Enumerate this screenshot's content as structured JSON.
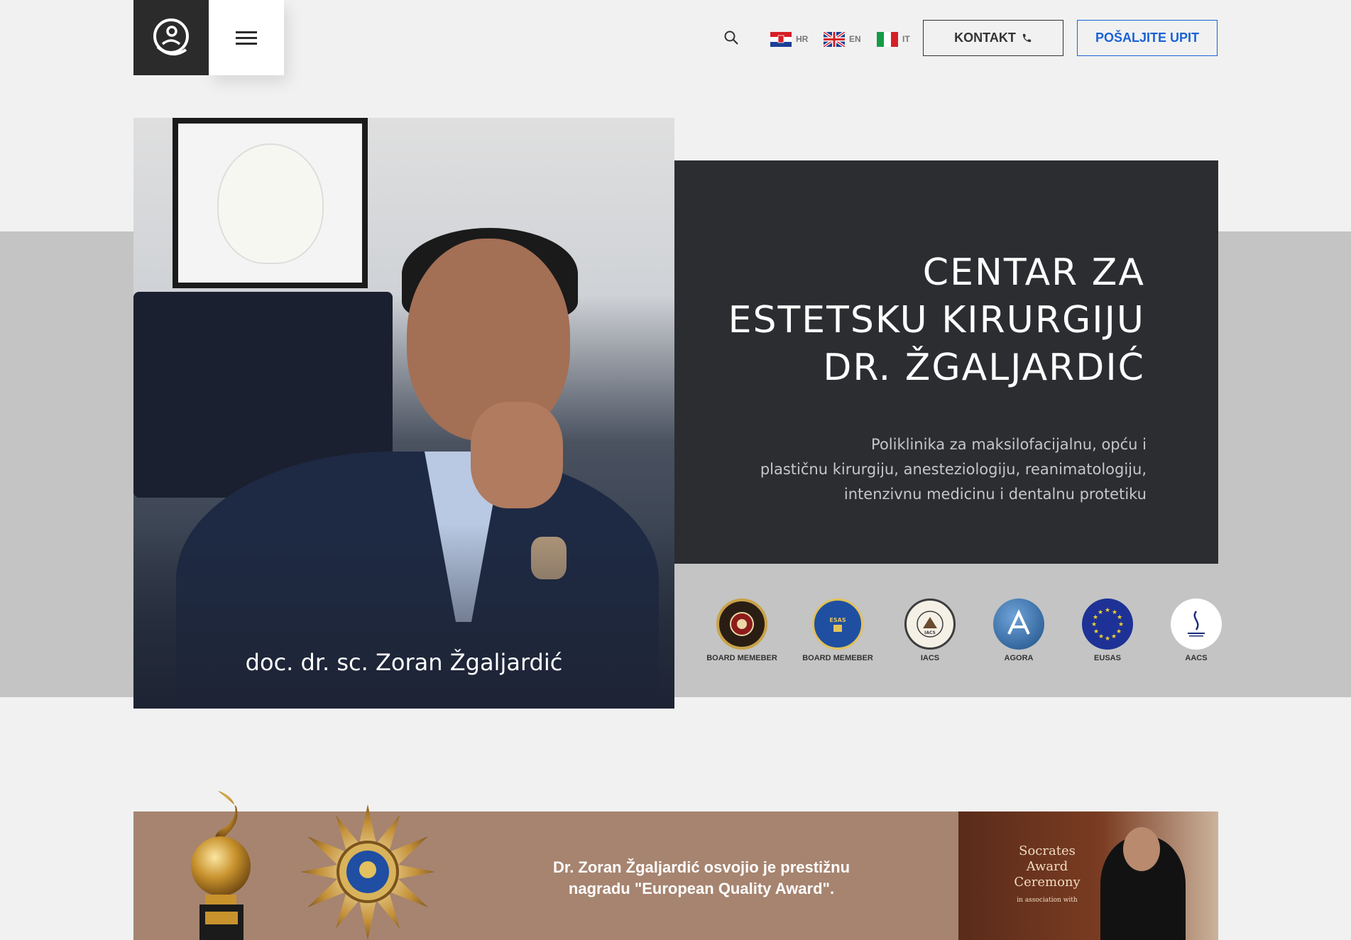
{
  "header": {
    "logo_alt": "logo",
    "languages": [
      {
        "code": "HR",
        "flag": "flag-hr"
      },
      {
        "code": "EN",
        "flag": "flag-uk"
      },
      {
        "code": "IT",
        "flag": "flag-it"
      }
    ],
    "contact_label": "KONTAKT",
    "inquiry_label": "POŠALJITE UPIT",
    "accent_color": "#1a62d6"
  },
  "hero": {
    "title_lines": [
      "CENTAR ZA",
      "ESTETSKU KIRURGIJU",
      "DR. ŽGALJARDIĆ"
    ],
    "subtitle_lines": [
      "Poliklinika za maksilofacijalnu, opću i",
      "plastičnu kirurgiju, anesteziologiju, reanimatologiju,",
      "intenzivnu medicinu i dentalnu protetiku"
    ],
    "photo_caption": "doc. dr. sc. Zoran Žgaljardić"
  },
  "badges": [
    {
      "label": "BOARD MEMEBER",
      "icon": "academy-seal-icon"
    },
    {
      "label": "BOARD MEMEBER",
      "icon": "esas-seal-icon"
    },
    {
      "label": "IACS",
      "icon": "iacs-seal-icon"
    },
    {
      "label": "AGORA",
      "icon": "agora-logo-icon"
    },
    {
      "label": "EUSAS",
      "icon": "eusas-stars-icon"
    },
    {
      "label": "AACS",
      "icon": "aacs-logo-icon"
    }
  ],
  "award": {
    "text_lines": [
      "Dr. Zoran Žgaljardić osvojio je prestižnu",
      "nagradu \"European Quality Award\"."
    ],
    "plaque_lines": [
      "Socrates",
      "Award",
      "Ceremony"
    ],
    "plaque_small": "in association with"
  }
}
